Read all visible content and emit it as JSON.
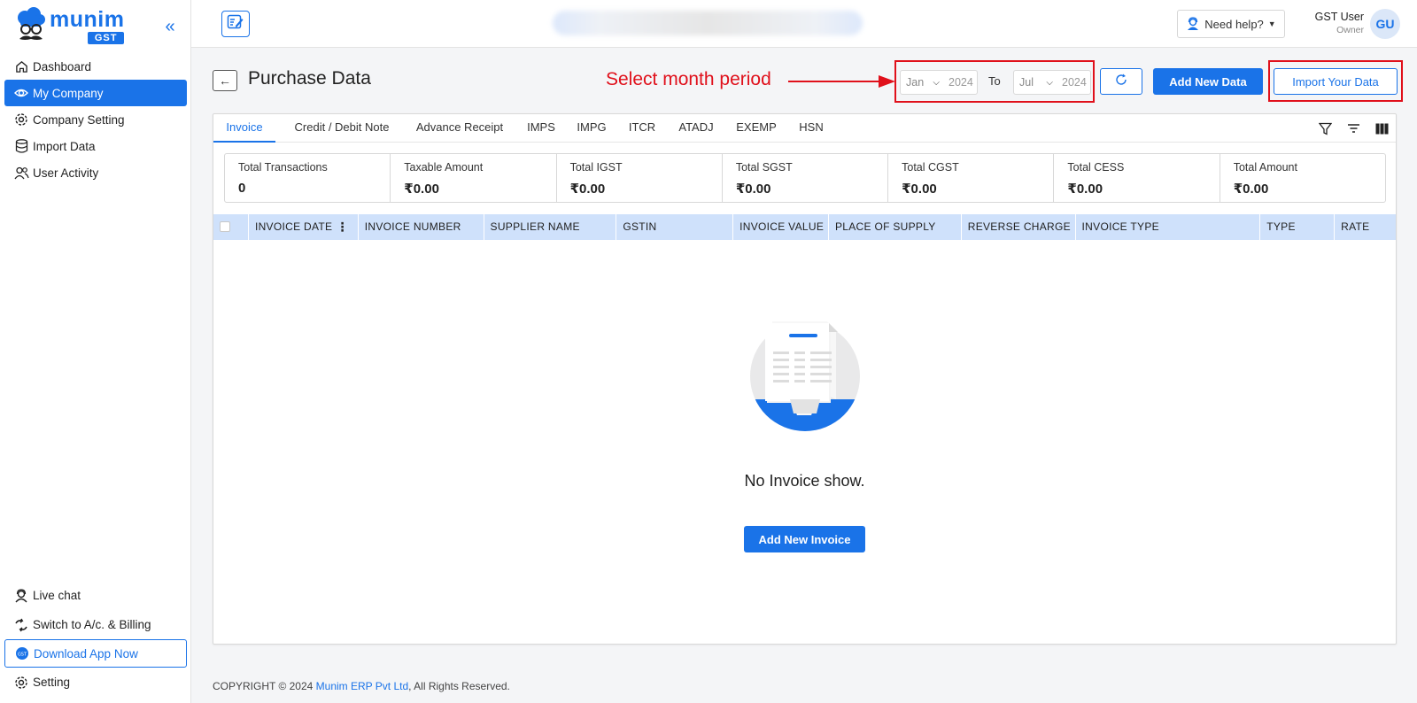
{
  "sidebar": {
    "logo_word": "munim",
    "logo_badge": "GST",
    "collapse_glyph": "«",
    "items": [
      {
        "label": "Dashboard",
        "icon": "home-icon"
      },
      {
        "label": "My Company",
        "icon": "eye-icon",
        "active": true
      },
      {
        "label": "Company Setting",
        "icon": "gear-icon"
      },
      {
        "label": "Import Data",
        "icon": "database-icon"
      },
      {
        "label": "User Activity",
        "icon": "users-icon"
      }
    ],
    "bottom_items": [
      {
        "label": "Live chat",
        "icon": "support-agent-icon"
      },
      {
        "label": "Switch to A/c. & Billing",
        "icon": "switch-icon"
      },
      {
        "label": "Download App Now",
        "icon": "app-badge-icon"
      },
      {
        "label": "Setting",
        "icon": "gear-icon"
      }
    ]
  },
  "topbar": {
    "help_label": "Need help?",
    "user_name": "GST User",
    "user_role": "Owner",
    "avatar_initials": "GU"
  },
  "header": {
    "title": "Purchase Data",
    "annotation": "Select month period",
    "from_month": "Jan",
    "from_year": "2024",
    "to_label": "To",
    "to_month": "Jul",
    "to_year": "2024",
    "add_new_data": "Add New Data",
    "import_data": "Import Your Data"
  },
  "tabs": [
    {
      "label": "Invoice",
      "active": true
    },
    {
      "label": "Credit / Debit Note"
    },
    {
      "label": "Advance Receipt"
    },
    {
      "label": "IMPS"
    },
    {
      "label": "IMPG"
    },
    {
      "label": "ITCR"
    },
    {
      "label": "ATADJ"
    },
    {
      "label": "EXEMP"
    },
    {
      "label": "HSN"
    }
  ],
  "stats": [
    {
      "label": "Total Transactions",
      "value": "0"
    },
    {
      "label": "Taxable Amount",
      "value": "₹0.00"
    },
    {
      "label": "Total IGST",
      "value": "₹0.00"
    },
    {
      "label": "Total SGST",
      "value": "₹0.00"
    },
    {
      "label": "Total CGST",
      "value": "₹0.00"
    },
    {
      "label": "Total CESS",
      "value": "₹0.00"
    },
    {
      "label": "Total Amount",
      "value": "₹0.00"
    }
  ],
  "table": {
    "columns": [
      "INVOICE DATE",
      "INVOICE NUMBER",
      "SUPPLIER NAME",
      "GSTIN",
      "INVOICE VALUE",
      "PLACE OF SUPPLY",
      "REVERSE CHARGE",
      "INVOICE TYPE",
      "TYPE",
      "RATE"
    ]
  },
  "empty_state": {
    "message": "No Invoice show.",
    "button": "Add New Invoice"
  },
  "footer": {
    "prefix": "COPYRIGHT © 2024 ",
    "company": "Munim ERP Pvt Ltd",
    "suffix": ", All Rights Reserved."
  },
  "colors": {
    "accent": "#1a73e8",
    "annotation_red": "#e0101b",
    "table_header": "#cfe1fb"
  }
}
